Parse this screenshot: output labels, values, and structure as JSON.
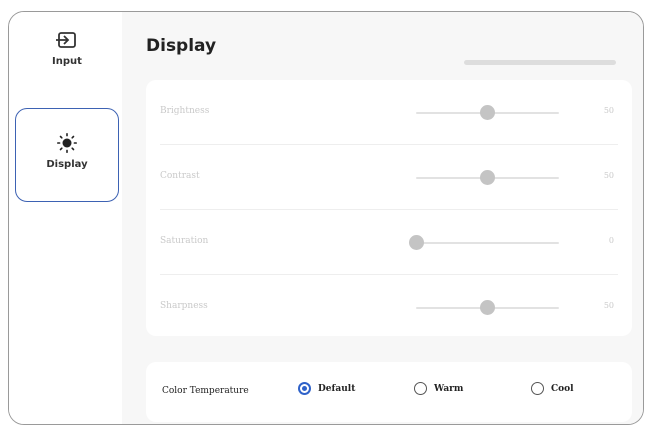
{
  "sidebar": {
    "items": [
      {
        "label": "Input",
        "icon": "input-icon",
        "selected": false
      },
      {
        "label": "Display",
        "icon": "brightness-icon",
        "selected": true
      }
    ]
  },
  "main": {
    "title": "Display",
    "sliders": [
      {
        "label": "Brightness",
        "value": "50",
        "level": 0.5
      },
      {
        "label": "Contrast",
        "value": "50",
        "level": 0.5
      },
      {
        "label": "Saturation",
        "value": "0",
        "level": 0.0
      },
      {
        "label": "Sharpness",
        "value": "50",
        "level": 0.5
      }
    ],
    "color_temperature": {
      "label": "Color Temperature",
      "options": [
        "Default",
        "Warm",
        "Cool"
      ],
      "selected": "Default"
    }
  },
  "colors": {
    "accent": "#2f62c9",
    "selected_border": "#3d62b3"
  }
}
